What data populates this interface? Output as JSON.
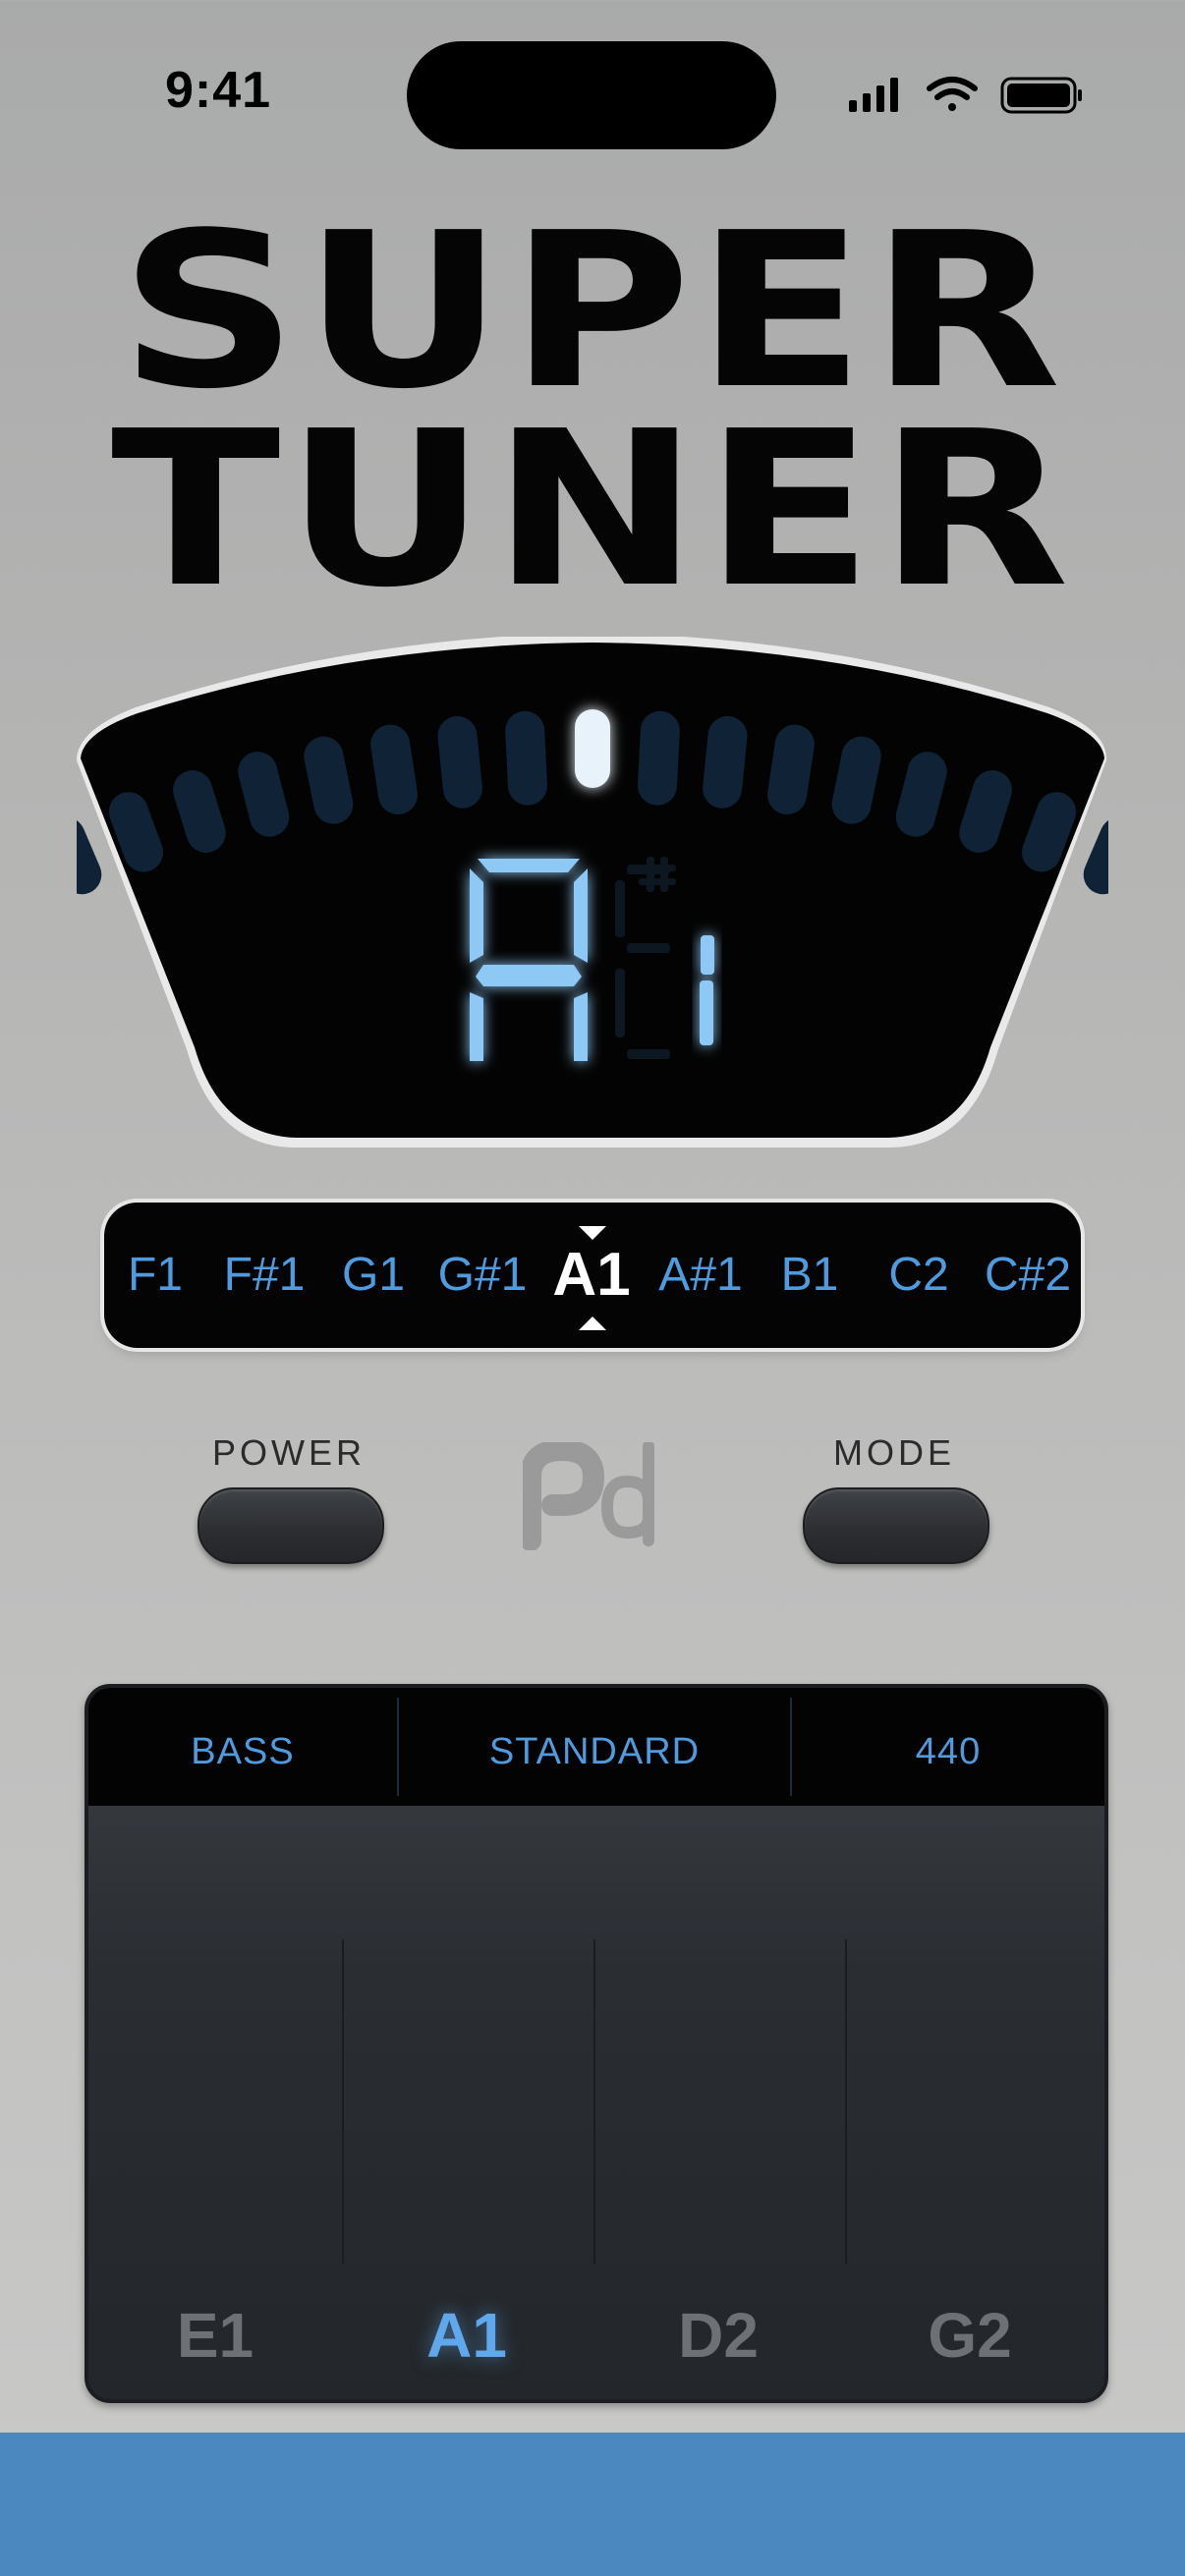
{
  "status_bar": {
    "time": "9:41"
  },
  "title": {
    "line1": "SUPER",
    "line2": "TUNER"
  },
  "display": {
    "note": "A",
    "octave": "1",
    "accidental": "#",
    "needle_position": "center"
  },
  "note_strip": {
    "notes": [
      "F1",
      "F#1",
      "G1",
      "G#1",
      "A1",
      "A#1",
      "B1",
      "C2",
      "C#2"
    ],
    "selected": "A1"
  },
  "controls": {
    "power_label": "POWER",
    "mode_label": "MODE",
    "logo_icon": "pd-logo-icon"
  },
  "tuning_panel": {
    "instrument": "BASS",
    "tuning": "STANDARD",
    "reference": "440",
    "strings": [
      "E1",
      "A1",
      "D2",
      "G2"
    ],
    "active_string": "A1"
  },
  "colors": {
    "accent": "#4f9be0",
    "lcd_glow": "#8ec8f5",
    "background": "#b4b4b3",
    "bottom_bar": "#4a88bf"
  }
}
